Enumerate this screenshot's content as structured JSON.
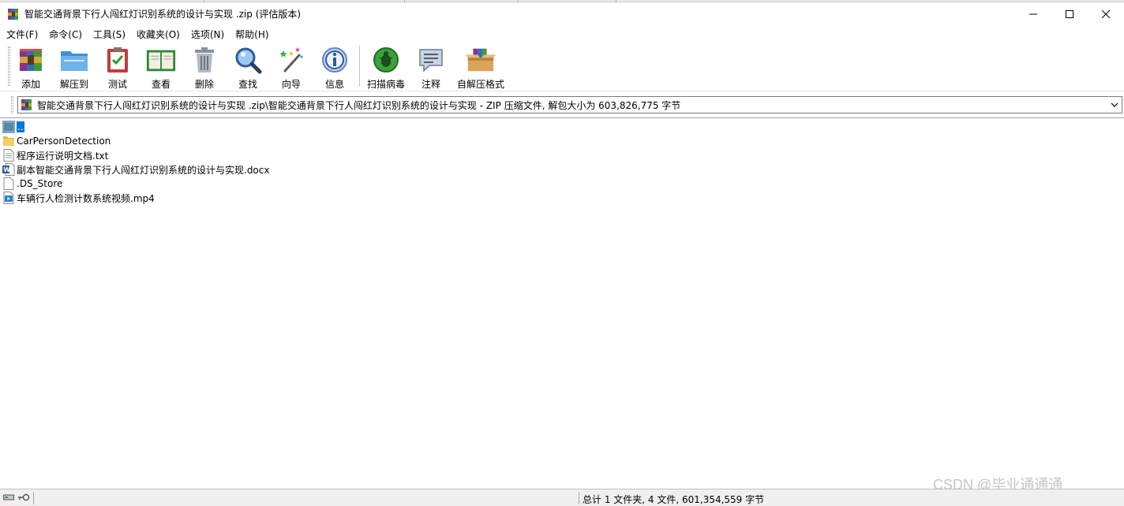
{
  "window": {
    "title": "智能交通背景下行人闯红灯识别系统的设计与实现 .zip (评估版本)",
    "minimize_icon": "minimize-icon",
    "maximize_icon": "maximize-icon",
    "close_icon": "close-icon"
  },
  "menu": [
    "文件(F)",
    "命令(C)",
    "工具(S)",
    "收藏夹(O)",
    "选项(N)",
    "帮助(H)"
  ],
  "toolbar": {
    "add": "添加",
    "extract": "解压到",
    "test": "测试",
    "view": "查看",
    "delete": "删除",
    "find": "查找",
    "wizard": "向导",
    "info": "信息",
    "scan": "扫描病毒",
    "comment": "注释",
    "sfx": "自解压格式"
  },
  "address": {
    "path": "智能交通背景下行人闯红灯识别系统的设计与实现 .zip\\智能交通背景下行人闯红灯识别系统的设计与实现  - ZIP 压缩文件, 解包大小为 603,826,775 字节"
  },
  "files": [
    {
      "name": "..",
      "icon": "parent-folder-icon"
    },
    {
      "name": "CarPersonDetection",
      "icon": "folder-icon"
    },
    {
      "name": "程序运行说明文档.txt",
      "icon": "text-file-icon"
    },
    {
      "name": "副本智能交通背景下行人闯红灯识别系统的设计与实现.docx",
      "icon": "word-file-icon"
    },
    {
      "name": ".DS_Store",
      "icon": "blank-file-icon"
    },
    {
      "name": "车辆行人检测计数系统视频.mp4",
      "icon": "video-file-icon"
    }
  ],
  "status": {
    "summary": "总计 1 文件夹, 4 文件, 601,354,559 字节"
  },
  "watermark": "CSDN @毕业通通通",
  "colors": {
    "selection": "#0078d7",
    "folder": "#f5cf62"
  }
}
